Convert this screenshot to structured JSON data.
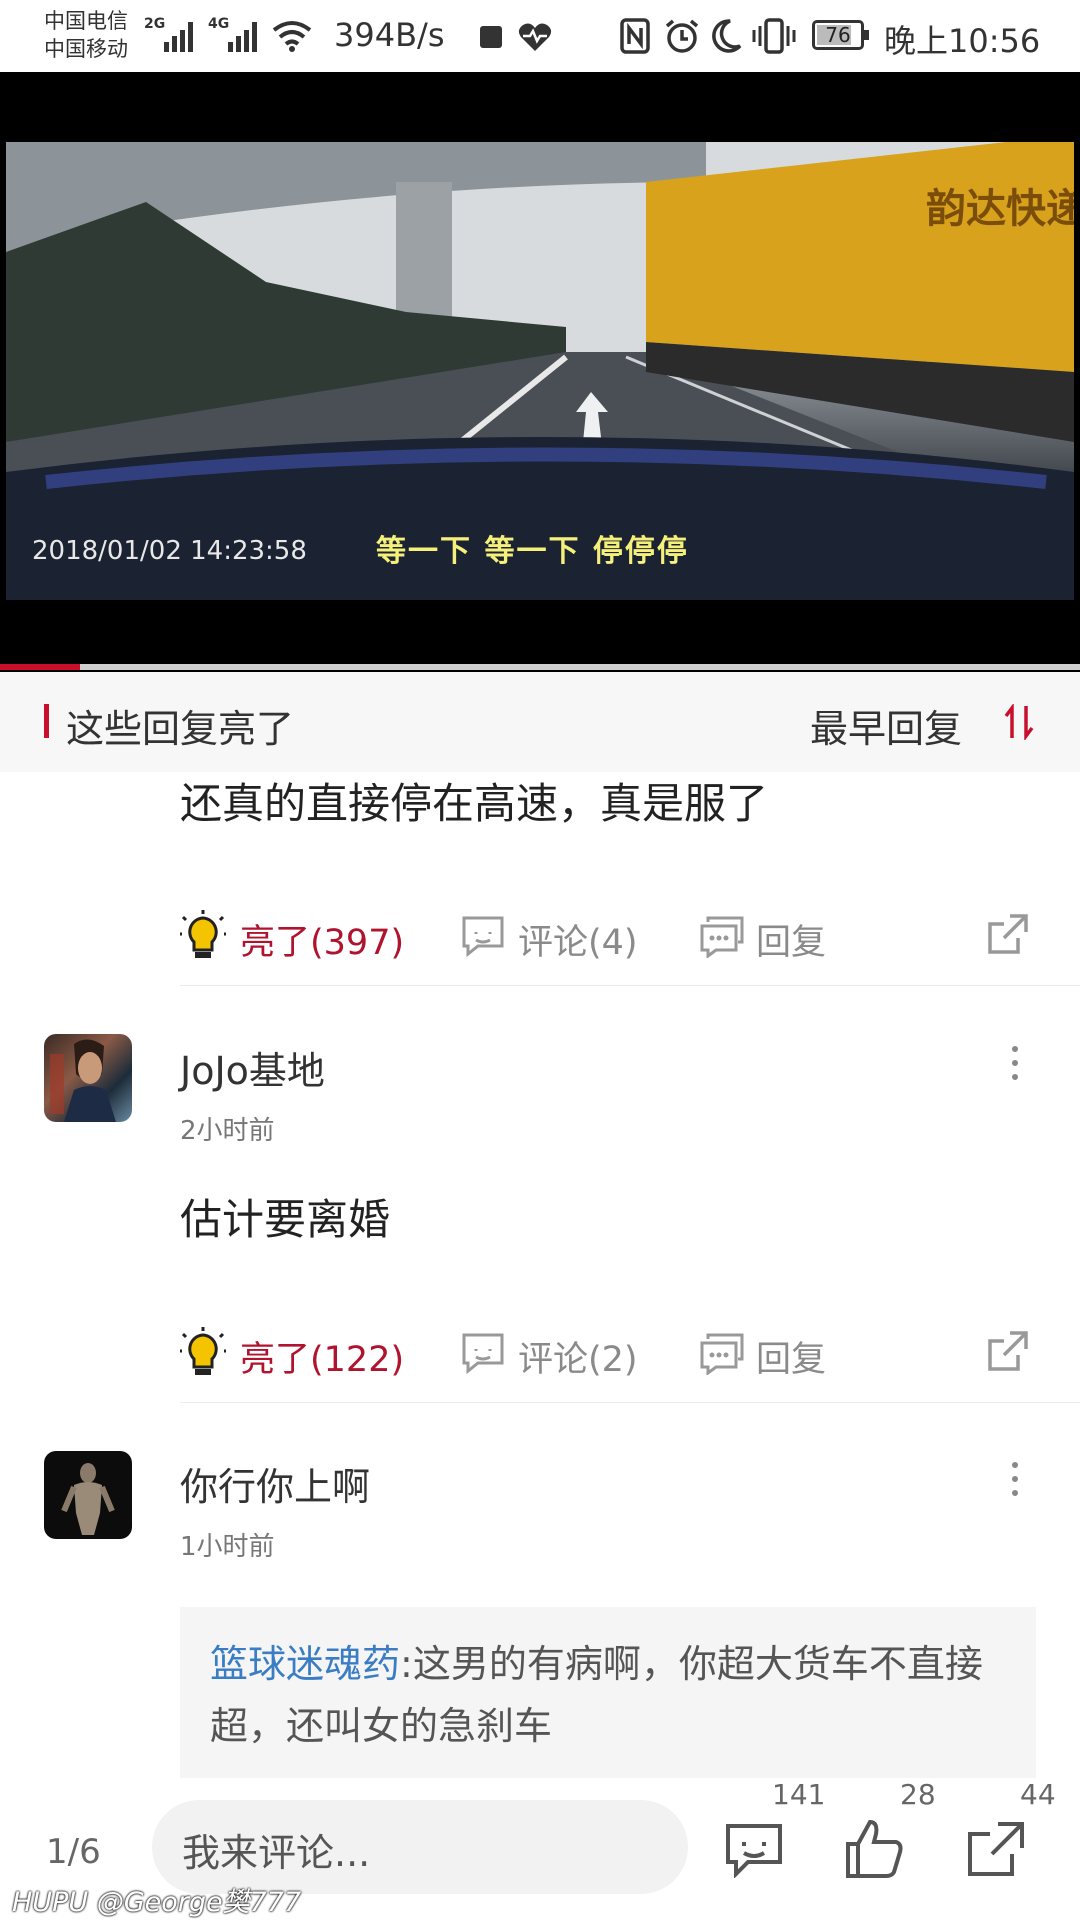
{
  "status_bar": {
    "carrier1": "中国电信",
    "carrier2": "中国移动",
    "net1": "2G",
    "net2": "4G",
    "speed": "394B/s",
    "battery": "76",
    "time": "晚上10:56"
  },
  "video": {
    "subtitle": "等一下 等一下 停停停",
    "timestamp": "2018/01/02  14:23:58",
    "truck_text": "韵达快递",
    "progress": 0.074
  },
  "section": {
    "title": "这些回复亮了",
    "sort_label": "最早回复"
  },
  "comments": [
    {
      "body": "还真的直接停在高速，真是服了",
      "likes_label": "亮了(397)",
      "comments_label": "评论(4)",
      "reply_label": "回复"
    },
    {
      "username": "JoJo基地",
      "time": "2小时前",
      "body": "估计要离婚",
      "likes_label": "亮了(122)",
      "comments_label": "评论(2)",
      "reply_label": "回复"
    },
    {
      "username": "你行你上啊",
      "time": "1小时前",
      "quote_author": "篮球迷魂药",
      "quote_text": ":这男的有病啊，你超大货车不直接超，还叫女的急刹车"
    }
  ],
  "bottom_bar": {
    "page_indicator": "1/6",
    "input_placeholder": "我来评论...",
    "comment_count": "141",
    "like_count": "28",
    "share_count": "44"
  },
  "watermark": {
    "brand": "HUPU",
    "user": "@George樊777"
  },
  "colors": {
    "accent_red": "#c8102e",
    "link_blue": "#3b7dc4",
    "bulb_yellow": "#f5c400"
  }
}
